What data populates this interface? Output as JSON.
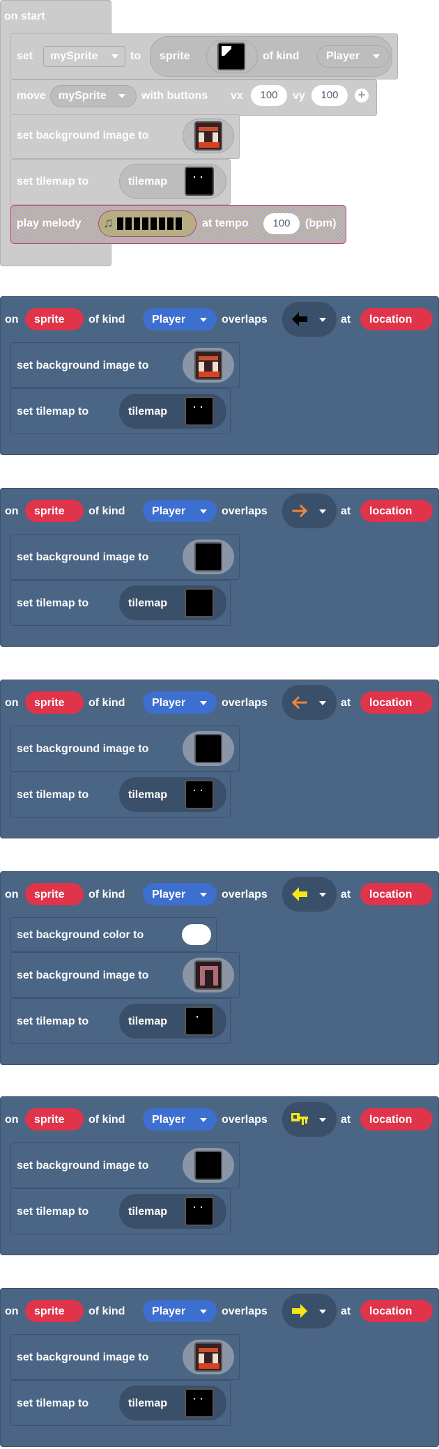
{
  "on_start": {
    "hat_label": "on start",
    "set_row": {
      "set": "set",
      "variable": "mySprite",
      "to": "to",
      "sprite": "sprite",
      "of_kind": "of kind",
      "kind": "Player"
    },
    "move_row": {
      "move": "move",
      "variable": "mySprite",
      "with_buttons": "with buttons",
      "vx_label": "vx",
      "vx": "100",
      "vy_label": "vy",
      "vy": "100"
    },
    "bg_row": {
      "label": "set background image to"
    },
    "tilemap_row": {
      "label": "set tilemap to",
      "pill": "tilemap"
    },
    "melody_row": {
      "play": "play melody",
      "at_tempo": "at tempo",
      "tempo": "100",
      "unit": "(bpm)"
    }
  },
  "events": [
    {
      "on": "on",
      "sprite": "sprite",
      "of_kind": "of kind",
      "kind": "Player",
      "overlaps": "overlaps",
      "at": "at",
      "location": "location",
      "tile_icon": "left-arrow-black-icon",
      "rows": [
        {
          "label": "set background image to"
        },
        {
          "label": "set tilemap to",
          "pill": "tilemap"
        }
      ]
    },
    {
      "on": "on",
      "sprite": "sprite",
      "of_kind": "of kind",
      "kind": "Player",
      "overlaps": "overlaps",
      "at": "at",
      "location": "location",
      "tile_icon": "right-arrow-orange-icon",
      "rows": [
        {
          "label": "set background image to"
        },
        {
          "label": "set tilemap to",
          "pill": "tilemap"
        }
      ]
    },
    {
      "on": "on",
      "sprite": "sprite",
      "of_kind": "of kind",
      "kind": "Player",
      "overlaps": "overlaps",
      "at": "at",
      "location": "location",
      "tile_icon": "left-arrow-orange-icon",
      "rows": [
        {
          "label": "set background image to"
        },
        {
          "label": "set tilemap to",
          "pill": "tilemap"
        }
      ]
    },
    {
      "on": "on",
      "sprite": "sprite",
      "of_kind": "of kind",
      "kind": "Player",
      "overlaps": "overlaps",
      "at": "at",
      "location": "location",
      "tile_icon": "left-arrow-yellow-icon",
      "rows": [
        {
          "label": "set background color to"
        },
        {
          "label": "set background image to"
        },
        {
          "label": "set tilemap to",
          "pill": "tilemap"
        }
      ]
    },
    {
      "on": "on",
      "sprite": "sprite",
      "of_kind": "of kind",
      "kind": "Player",
      "overlaps": "overlaps",
      "at": "at",
      "location": "location",
      "tile_icon": "key-yellow-icon",
      "rows": [
        {
          "label": "set background image to"
        },
        {
          "label": "set tilemap to",
          "pill": "tilemap"
        }
      ]
    },
    {
      "on": "on",
      "sprite": "sprite",
      "of_kind": "of kind",
      "kind": "Player",
      "overlaps": "overlaps",
      "at": "at",
      "location": "location",
      "tile_icon": "right-arrow-yellow-icon",
      "rows": [
        {
          "label": "set background image to"
        },
        {
          "label": "set tilemap to",
          "pill": "tilemap"
        }
      ]
    }
  ],
  "colors": {
    "event_block": "#4b6584",
    "sprite_pill": "#e0344b",
    "kind_pill": "#3d6fd0",
    "disabled_block": "#cccccc",
    "melody_block": "#cfc26a"
  }
}
